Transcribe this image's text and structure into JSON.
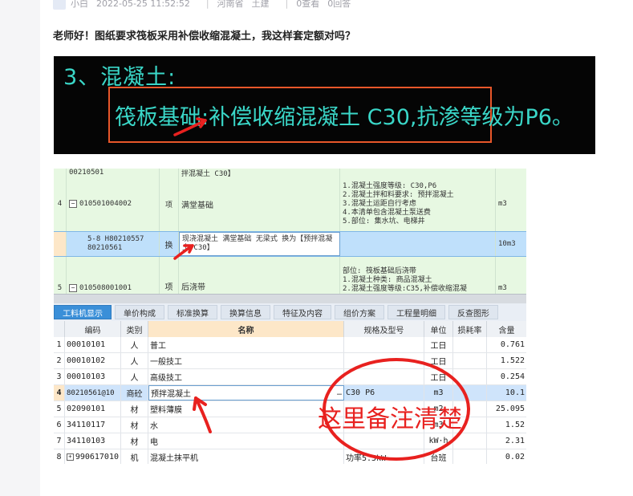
{
  "post": {
    "author": "小白",
    "datetime": "2022-05-25 11:52:52",
    "region": "河南省",
    "category": "土建",
    "views": "0查看",
    "answers": "0回答",
    "question": "老师好！图纸要求筏板采用补偿收缩混凝土，我这样套定额对吗？"
  },
  "cad": {
    "heading": "3、混凝土:",
    "boxed_text": "筏板基础:补偿收缩混凝土 C30,抗渗等级为P6。"
  },
  "upper_table": {
    "rows": [
      {
        "no": "",
        "code": "00210501",
        "type": "",
        "name": "拌混凝土 C30】",
        "desc": [
          ""
        ],
        "unit": ""
      },
      {
        "no": "4",
        "code": "010501004002",
        "type": "项",
        "name": "满堂基础",
        "desc": [
          "1.混凝土强度等级: C30,P6",
          "2.混凝土拌和料要求: 预拌混凝土",
          "3.混凝土运距自行考虑",
          "4.本清单包含混凝土泵送费",
          "5.部位: 集水坑、电梯井"
        ],
        "unit": "m3"
      },
      {
        "no": "",
        "code": "5-8 H80210557 80210561",
        "type": "换",
        "name": "现浇混凝土 满堂基础 无梁式 换为【预拌混凝土 C30】",
        "desc": [
          ""
        ],
        "unit": "10m3"
      },
      {
        "no": "5",
        "code": "010508001001",
        "type": "项",
        "name": "后浇带",
        "desc": [
          "部位: 筏板基础后浇带",
          "1.混凝土种类: 商品混凝土",
          "2.混凝土强度等级:C35,补偿收缩混凝"
        ],
        "unit": "m3"
      }
    ]
  },
  "tabs": [
    "工料机显示",
    "单价构成",
    "标准换算",
    "换算信息",
    "特征及内容",
    "组价方案",
    "工程量明细",
    "反查图形"
  ],
  "lower_table": {
    "headers": [
      "",
      "编码",
      "类别",
      "名称",
      "规格及型号",
      "单位",
      "损耗率",
      "含量"
    ],
    "rows": [
      {
        "no": "1",
        "code": "00010101",
        "cat": "人",
        "name": "普工",
        "spec": "",
        "unit": "工日",
        "loss": "",
        "qty": "0.761"
      },
      {
        "no": "2",
        "code": "00010102",
        "cat": "人",
        "name": "一般技工",
        "spec": "",
        "unit": "工日",
        "loss": "",
        "qty": "1.522"
      },
      {
        "no": "3",
        "code": "00010103",
        "cat": "人",
        "name": "高级技工",
        "spec": "",
        "unit": "工日",
        "loss": "",
        "qty": "0.254"
      },
      {
        "no": "4",
        "code": "80210561@10",
        "cat": "商砼",
        "name": "预拌混凝土",
        "spec": "C30 P6",
        "unit": "m3",
        "loss": "",
        "qty": "10.1"
      },
      {
        "no": "5",
        "code": "02090101",
        "cat": "材",
        "name": "塑料薄膜",
        "spec": "",
        "unit": "m2",
        "loss": "",
        "qty": "25.095"
      },
      {
        "no": "6",
        "code": "34110117",
        "cat": "材",
        "name": "水",
        "spec": "",
        "unit": "m3",
        "loss": "",
        "qty": "1.52"
      },
      {
        "no": "7",
        "code": "34110103",
        "cat": "材",
        "name": "电",
        "spec": "",
        "unit": "kW·h",
        "loss": "",
        "qty": "2.31"
      },
      {
        "no": "8",
        "code": "990617010",
        "cat": "机",
        "name": "混凝土抹平机",
        "spec": "功率5.5kW",
        "unit": "台班",
        "loss": "",
        "qty": "0.02"
      }
    ]
  },
  "annotation": {
    "text": "这里备注清楚"
  },
  "colors": {
    "cad_text": "#3ad7c8",
    "highlight_box": "#e8572a",
    "annotation_red": "#e8211f",
    "tab_active": "#3a8fd8",
    "row_selected": "#cfe4fb",
    "upper_green": "#e7f8e2",
    "upper_selected": "#bfe0fb"
  }
}
